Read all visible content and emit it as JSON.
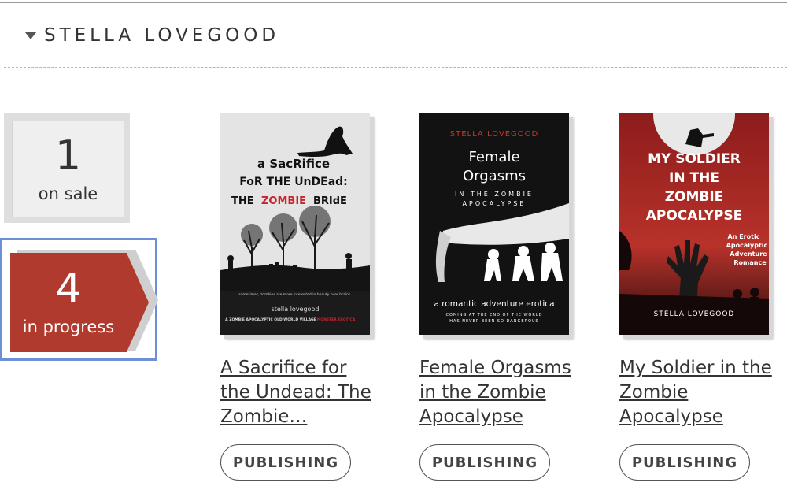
{
  "author": {
    "name": "STELLA LOVEGOOD"
  },
  "summary": {
    "on_sale": {
      "count": "1",
      "label": "on sale"
    },
    "in_progress": {
      "count": "4",
      "label": "in progress"
    }
  },
  "books": [
    {
      "title": "A Sacrifice for the Undead: The Zombie…",
      "status": "PUBLISHING",
      "cover": {
        "line1": "a SacRifice",
        "line2": "FoR THE UnDEad:",
        "line3_a": "THE",
        "line3_b": "ZOMBIE",
        "line3_c": "BRIdE",
        "tagline": "sometimes, zombies are more interested in beauty over brains.",
        "author": "stella lovegood",
        "series_a": "A ZOMBIE APOCALYPTIC OLD WORLD VILLAGE",
        "series_b": "MONSTER EROTICA"
      }
    },
    {
      "title": "Female Orgasms in the Zombie Apocalypse",
      "status": "PUBLISHING",
      "cover": {
        "author": "STELLA LOVEGOOD",
        "line1": "Female",
        "line2": "Orgasms",
        "line3": "IN THE ZOMBIE",
        "line4": "APOCALYPSE",
        "subtitle": "a romantic adventure erotica",
        "tag1": "COMING AT THE END OF THE WORLD",
        "tag2": "HAS NEVER BEEN SO DANGEROUS"
      }
    },
    {
      "title": "My Soldier in the Zombie Apocalypse",
      "status": "PUBLISHING",
      "cover": {
        "line1": "MY SOLDIER",
        "line2": "IN THE",
        "line3": "ZOMBIE",
        "line4": "APOCALYPSE",
        "sub1": "An Erotic",
        "sub2": "Apocalyptic",
        "sub3": "Adventure",
        "sub4": "Romance",
        "author": "STELLA LOVEGOOD"
      }
    }
  ]
}
